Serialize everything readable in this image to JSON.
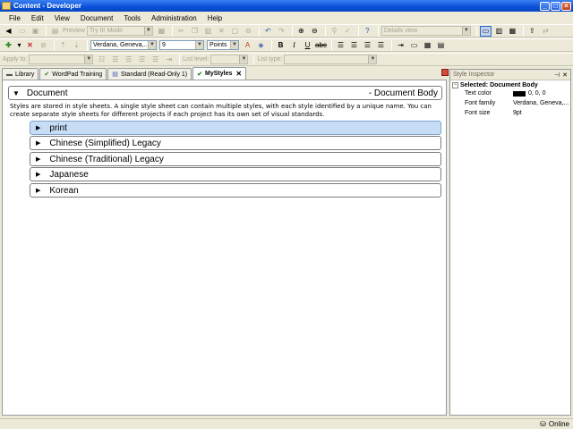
{
  "window": {
    "title": "Content - Developer"
  },
  "menu": [
    "File",
    "Edit",
    "View",
    "Document",
    "Tools",
    "Administration",
    "Help"
  ],
  "toolbar1": {
    "preview_label": "Preview",
    "mode_select": "Try It! Mode",
    "view_select": "Details view"
  },
  "toolbar2": {
    "font_family": "Verdana, Geneva,...",
    "font_size": "9",
    "size_unit": "Points"
  },
  "toolbar3": {
    "apply_to_label": "Apply to:",
    "list_level_label": "List level:",
    "list_type_label": "List type:"
  },
  "tabs": [
    {
      "label": "Library"
    },
    {
      "label": "WordPad Training"
    },
    {
      "label": "Standard (Read-Only 1)"
    },
    {
      "label": "MyStyles",
      "active": true
    }
  ],
  "document": {
    "header_left": "Document",
    "header_right": "- Document Body",
    "description": "Styles are stored in style sheets. A single style sheet can contain multiple styles, with each style identified by a unique name. You can create separate style sheets for different projects if each project has its own set of visual standards.",
    "styles": [
      {
        "label": "print",
        "selected": true
      },
      {
        "label": "Chinese (Simplified) Legacy"
      },
      {
        "label": "Chinese (Traditional) Legacy"
      },
      {
        "label": "Japanese"
      },
      {
        "label": "Korean"
      }
    ]
  },
  "inspector": {
    "title": "Style Inspector",
    "selected": "Selected: Document Body",
    "props": [
      {
        "key": "Text color",
        "value": "0, 0, 0",
        "swatch": "#000000"
      },
      {
        "key": "Font family",
        "value": "Verdana, Geneva,..."
      },
      {
        "key": "Font size",
        "value": "9pt"
      }
    ]
  },
  "status": {
    "text": "Online"
  }
}
